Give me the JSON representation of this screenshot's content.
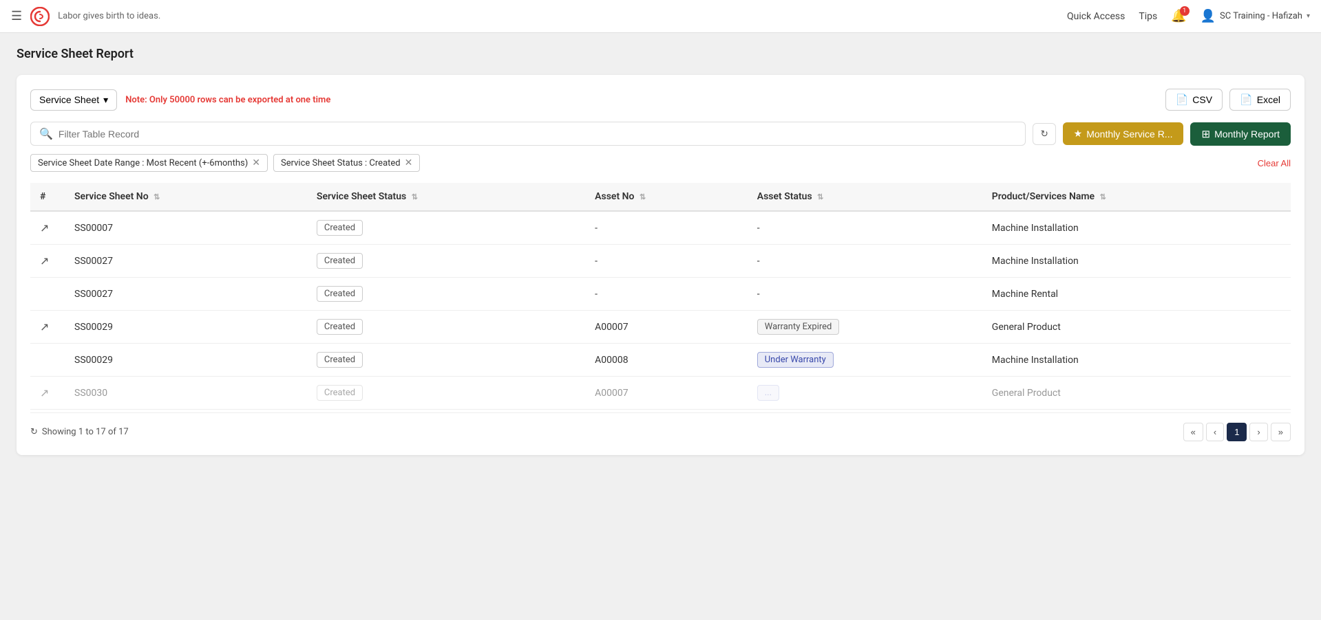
{
  "topnav": {
    "tagline": "Labor gives birth to ideas.",
    "quick_access": "Quick Access",
    "tips": "Tips",
    "bell_count": "1",
    "user_name": "SC Training - Hafizah",
    "chevron": "▾"
  },
  "page": {
    "title": "Service Sheet Report"
  },
  "toolbar": {
    "dropdown_label": "Service Sheet",
    "note": "Note: Only 50000 rows can be exported at ",
    "note_highlight": "one time",
    "csv_label": "CSV",
    "excel_label": "Excel"
  },
  "search": {
    "placeholder": "Filter Table Record"
  },
  "action_buttons": {
    "monthly_service": "Monthly Service R...",
    "monthly_report": "Monthly Report"
  },
  "filters": {
    "filter1": "Service Sheet Date Range : Most Recent (+-6months)",
    "filter2": "Service Sheet Status : Created",
    "clear_all": "Clear All"
  },
  "table": {
    "columns": [
      "#",
      "Service Sheet No",
      "Service Sheet Status",
      "Asset No",
      "Asset Status",
      "Product/Services Name"
    ],
    "rows": [
      {
        "has_icon": true,
        "ss_no": "SS00007",
        "status": "Created",
        "status_type": "created",
        "asset_no": "-",
        "asset_status": "-",
        "asset_status_type": "none",
        "product": "Machine Installation"
      },
      {
        "has_icon": true,
        "ss_no": "SS00027",
        "status": "Created",
        "status_type": "created",
        "asset_no": "-",
        "asset_status": "-",
        "asset_status_type": "none",
        "product": "Machine Installation"
      },
      {
        "has_icon": false,
        "ss_no": "SS00027",
        "status": "Created",
        "status_type": "created",
        "asset_no": "-",
        "asset_status": "-",
        "asset_status_type": "none",
        "product": "Machine Rental"
      },
      {
        "has_icon": true,
        "ss_no": "SS00029",
        "status": "Created",
        "status_type": "created",
        "asset_no": "A00007",
        "asset_status": "Warranty Expired",
        "asset_status_type": "warranty-expired",
        "product": "General Product"
      },
      {
        "has_icon": false,
        "ss_no": "SS00029",
        "status": "Created",
        "status_type": "created",
        "asset_no": "A00008",
        "asset_status": "Under Warranty",
        "asset_status_type": "under-warranty",
        "product": "Machine Installation"
      },
      {
        "has_icon": true,
        "ss_no": "SS0030",
        "status": "Created",
        "status_type": "created",
        "asset_no": "A00007",
        "asset_status": "",
        "asset_status_type": "partial",
        "product": "General Product"
      }
    ]
  },
  "pagination": {
    "showing": "Showing 1 to 17 of 17",
    "current_page": "1",
    "pages": [
      "1"
    ]
  },
  "icons": {
    "hamburger": "☰",
    "open_link": "⬡",
    "sort": "⇅",
    "search": "🔍",
    "refresh": "↻",
    "star": "★",
    "grid": "⊞",
    "file": "📄",
    "user": "👤",
    "bell": "🔔",
    "first_page": "«",
    "prev_page": "‹",
    "next_page": "›",
    "last_page": "»"
  }
}
